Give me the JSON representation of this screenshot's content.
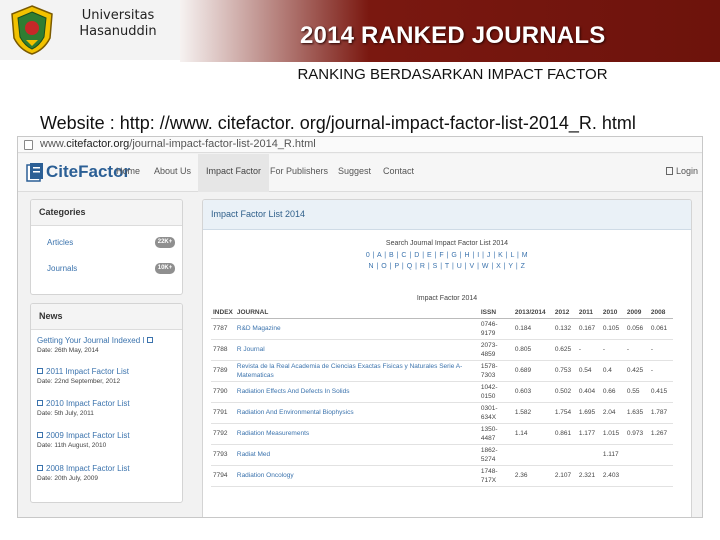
{
  "header": {
    "university_line1": "Universitas",
    "university_line2": "Hasanuddin",
    "title": "2014 RANKED JOURNALS",
    "subtitle": "RANKING BERDASARKAN IMPACT FACTOR",
    "website": "Website : http: //www. citefactor. org/journal-impact-factor-list-2014_R. html"
  },
  "browser": {
    "url_prefix": "www.",
    "url_domain": "citefactor.org",
    "url_path": "/journal-impact-factor-list-2014_R.html"
  },
  "site": {
    "logo": "CiteFactor",
    "nav": [
      "Home",
      "About Us",
      "Impact Factor",
      "For Publishers",
      "Suggest",
      "Contact"
    ],
    "active_nav": "Impact Factor",
    "login": "Login"
  },
  "categories": {
    "title": "Categories",
    "items": [
      {
        "label": "Articles",
        "badge": "22K+"
      },
      {
        "label": "Journals",
        "badge": "10K+"
      }
    ]
  },
  "news": {
    "title": "News",
    "items": [
      {
        "title": "Getting Your Journal Indexed I",
        "date": "Date: 26th May, 2014",
        "icon": false
      },
      {
        "title": "2011 Impact Factor List",
        "date": "Date: 22nd September, 2012",
        "icon": true
      },
      {
        "title": "2010 Impact Factor List",
        "date": "Date: 5th July, 2011",
        "icon": true
      },
      {
        "title": "2009 Impact Factor List",
        "date": "Date: 11th August, 2010",
        "icon": true
      },
      {
        "title": "2008 Impact Factor List",
        "date": "Date: 20th July, 2009",
        "icon": true
      }
    ]
  },
  "main": {
    "heading": "Impact Factor List 2014",
    "search_label": "Search Journal Impact Factor List 2014",
    "alpha_row1": "0 | A | B | C | D | E | F | G | H | I | J | K | L | M",
    "alpha_row2": "N | O | P | Q | R | S | T | U | V | W | X | Y | Z",
    "if_label": "Impact Factor 2014"
  },
  "table": {
    "columns": [
      "INDEX",
      "JOURNAL",
      "ISSN",
      "2013/2014",
      "2012",
      "2011",
      "2010",
      "2009",
      "2008"
    ],
    "rows": [
      [
        "7787",
        "R&D Magazine",
        "0746-9179",
        "0.184",
        "0.132",
        "0.167",
        "0.105",
        "0.056",
        "0.061"
      ],
      [
        "7788",
        "R Journal",
        "2073-4859",
        "0.805",
        "0.625",
        "-",
        "-",
        "-",
        "-"
      ],
      [
        "7789",
        "Revista de la Real Academia de Ciencias Exactas Fisicas y Naturales Serie A-Matematicas",
        "1578-7303",
        "0.689",
        "0.753",
        "0.54",
        "0.4",
        "0.425",
        "-"
      ],
      [
        "7790",
        "Radiation Effects And Defects In Solids",
        "1042-0150",
        "0.603",
        "0.502",
        "0.404",
        "0.66",
        "0.55",
        "0.415"
      ],
      [
        "7791",
        "Radiation And Environmental Biophysics",
        "0301-634X",
        "1.582",
        "1.754",
        "1.695",
        "2.04",
        "1.635",
        "1.787"
      ],
      [
        "7792",
        "Radiation Measurements",
        "1350-4487",
        "1.14",
        "0.861",
        "1.177",
        "1.015",
        "0.973",
        "1.267"
      ],
      [
        "7793",
        "Radiat Med",
        "1862-5274",
        "",
        "",
        "",
        "1.117",
        "",
        ""
      ],
      [
        "7794",
        "Radiation Oncology",
        "1748-717X",
        "2.36",
        "2.107",
        "2.321",
        "2.403",
        "",
        ""
      ]
    ]
  },
  "colors": {
    "header_red": "#6d130c",
    "link_blue": "#3b73ad",
    "logo_blue": "#2b5f95",
    "badge_gray": "#8f8f8f"
  }
}
